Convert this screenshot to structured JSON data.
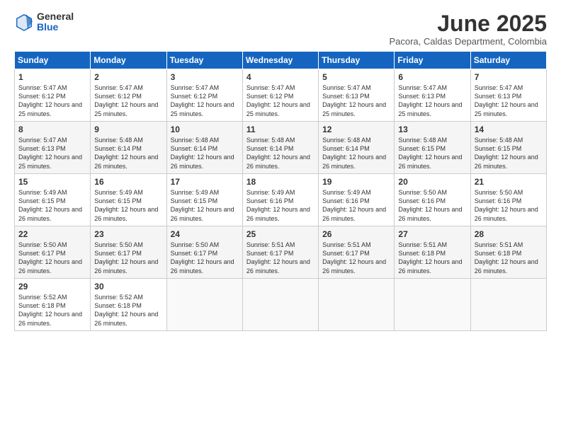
{
  "logo": {
    "general": "General",
    "blue": "Blue"
  },
  "title": "June 2025",
  "location": "Pacora, Caldas Department, Colombia",
  "weekdays": [
    "Sunday",
    "Monday",
    "Tuesday",
    "Wednesday",
    "Thursday",
    "Friday",
    "Saturday"
  ],
  "weeks": [
    [
      {
        "day": "1",
        "sunrise": "5:47 AM",
        "sunset": "6:12 PM",
        "daylight": "12 hours and 25 minutes."
      },
      {
        "day": "2",
        "sunrise": "5:47 AM",
        "sunset": "6:12 PM",
        "daylight": "12 hours and 25 minutes."
      },
      {
        "day": "3",
        "sunrise": "5:47 AM",
        "sunset": "6:12 PM",
        "daylight": "12 hours and 25 minutes."
      },
      {
        "day": "4",
        "sunrise": "5:47 AM",
        "sunset": "6:12 PM",
        "daylight": "12 hours and 25 minutes."
      },
      {
        "day": "5",
        "sunrise": "5:47 AM",
        "sunset": "6:13 PM",
        "daylight": "12 hours and 25 minutes."
      },
      {
        "day": "6",
        "sunrise": "5:47 AM",
        "sunset": "6:13 PM",
        "daylight": "12 hours and 25 minutes."
      },
      {
        "day": "7",
        "sunrise": "5:47 AM",
        "sunset": "6:13 PM",
        "daylight": "12 hours and 25 minutes."
      }
    ],
    [
      {
        "day": "8",
        "sunrise": "5:47 AM",
        "sunset": "6:13 PM",
        "daylight": "12 hours and 25 minutes."
      },
      {
        "day": "9",
        "sunrise": "5:48 AM",
        "sunset": "6:14 PM",
        "daylight": "12 hours and 26 minutes."
      },
      {
        "day": "10",
        "sunrise": "5:48 AM",
        "sunset": "6:14 PM",
        "daylight": "12 hours and 26 minutes."
      },
      {
        "day": "11",
        "sunrise": "5:48 AM",
        "sunset": "6:14 PM",
        "daylight": "12 hours and 26 minutes."
      },
      {
        "day": "12",
        "sunrise": "5:48 AM",
        "sunset": "6:14 PM",
        "daylight": "12 hours and 26 minutes."
      },
      {
        "day": "13",
        "sunrise": "5:48 AM",
        "sunset": "6:15 PM",
        "daylight": "12 hours and 26 minutes."
      },
      {
        "day": "14",
        "sunrise": "5:48 AM",
        "sunset": "6:15 PM",
        "daylight": "12 hours and 26 minutes."
      }
    ],
    [
      {
        "day": "15",
        "sunrise": "5:49 AM",
        "sunset": "6:15 PM",
        "daylight": "12 hours and 26 minutes."
      },
      {
        "day": "16",
        "sunrise": "5:49 AM",
        "sunset": "6:15 PM",
        "daylight": "12 hours and 26 minutes."
      },
      {
        "day": "17",
        "sunrise": "5:49 AM",
        "sunset": "6:15 PM",
        "daylight": "12 hours and 26 minutes."
      },
      {
        "day": "18",
        "sunrise": "5:49 AM",
        "sunset": "6:16 PM",
        "daylight": "12 hours and 26 minutes."
      },
      {
        "day": "19",
        "sunrise": "5:49 AM",
        "sunset": "6:16 PM",
        "daylight": "12 hours and 26 minutes."
      },
      {
        "day": "20",
        "sunrise": "5:50 AM",
        "sunset": "6:16 PM",
        "daylight": "12 hours and 26 minutes."
      },
      {
        "day": "21",
        "sunrise": "5:50 AM",
        "sunset": "6:16 PM",
        "daylight": "12 hours and 26 minutes."
      }
    ],
    [
      {
        "day": "22",
        "sunrise": "5:50 AM",
        "sunset": "6:17 PM",
        "daylight": "12 hours and 26 minutes."
      },
      {
        "day": "23",
        "sunrise": "5:50 AM",
        "sunset": "6:17 PM",
        "daylight": "12 hours and 26 minutes."
      },
      {
        "day": "24",
        "sunrise": "5:50 AM",
        "sunset": "6:17 PM",
        "daylight": "12 hours and 26 minutes."
      },
      {
        "day": "25",
        "sunrise": "5:51 AM",
        "sunset": "6:17 PM",
        "daylight": "12 hours and 26 minutes."
      },
      {
        "day": "26",
        "sunrise": "5:51 AM",
        "sunset": "6:17 PM",
        "daylight": "12 hours and 26 minutes."
      },
      {
        "day": "27",
        "sunrise": "5:51 AM",
        "sunset": "6:18 PM",
        "daylight": "12 hours and 26 minutes."
      },
      {
        "day": "28",
        "sunrise": "5:51 AM",
        "sunset": "6:18 PM",
        "daylight": "12 hours and 26 minutes."
      }
    ],
    [
      {
        "day": "29",
        "sunrise": "5:52 AM",
        "sunset": "6:18 PM",
        "daylight": "12 hours and 26 minutes."
      },
      {
        "day": "30",
        "sunrise": "5:52 AM",
        "sunset": "6:18 PM",
        "daylight": "12 hours and 26 minutes."
      },
      null,
      null,
      null,
      null,
      null
    ]
  ]
}
